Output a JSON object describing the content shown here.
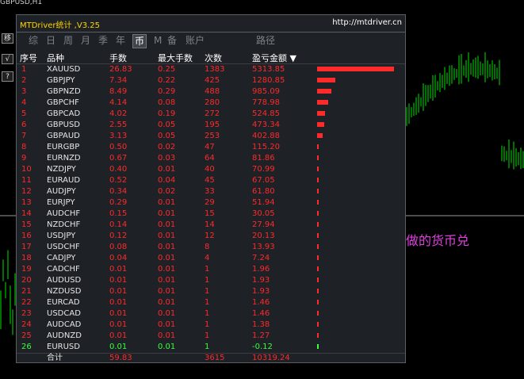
{
  "chart": {
    "title": "GBPUSD,H1",
    "overlay_text": "金蝉子做的货币兑"
  },
  "side_buttons": [
    "移",
    "√",
    "?"
  ],
  "panel": {
    "title": "MTDriver统计 ,V3.25",
    "url": "http://mtdriver.cn",
    "tabs": [
      "综",
      "日",
      "周",
      "月",
      "季",
      "年",
      "币",
      "M",
      "备",
      "账户",
      "路径"
    ],
    "active_tab": "币",
    "columns": {
      "idx": "序号",
      "symbol": "品种",
      "lots": "手数",
      "max_lots": "最大手数",
      "count": "次数",
      "pnl": "盈亏金额 ▼"
    },
    "rows": [
      {
        "idx": "1",
        "symbol": "XAUUSD",
        "lots": "26.83",
        "max_lots": "0.25",
        "count": "1383",
        "pnl": "5313.85",
        "value": 5313.85
      },
      {
        "idx": "2",
        "symbol": "GBPJPY",
        "lots": "7.34",
        "max_lots": "0.22",
        "count": "425",
        "pnl": "1280.85",
        "value": 1280.85
      },
      {
        "idx": "3",
        "symbol": "GBPNZD",
        "lots": "8.49",
        "max_lots": "0.29",
        "count": "488",
        "pnl": "985.09",
        "value": 985.09
      },
      {
        "idx": "4",
        "symbol": "GBPCHF",
        "lots": "4.14",
        "max_lots": "0.08",
        "count": "280",
        "pnl": "778.98",
        "value": 778.98
      },
      {
        "idx": "5",
        "symbol": "GBPCAD",
        "lots": "4.02",
        "max_lots": "0.19",
        "count": "272",
        "pnl": "524.85",
        "value": 524.85
      },
      {
        "idx": "6",
        "symbol": "GBPUSD",
        "lots": "2.55",
        "max_lots": "0.05",
        "count": "195",
        "pnl": "473.34",
        "value": 473.34
      },
      {
        "idx": "7",
        "symbol": "GBPAUD",
        "lots": "3.13",
        "max_lots": "0.05",
        "count": "253",
        "pnl": "402.88",
        "value": 402.88
      },
      {
        "idx": "8",
        "symbol": "EURGBP",
        "lots": "0.50",
        "max_lots": "0.02",
        "count": "47",
        "pnl": "115.20",
        "value": 115.2
      },
      {
        "idx": "9",
        "symbol": "EURNZD",
        "lots": "0.67",
        "max_lots": "0.03",
        "count": "64",
        "pnl": "81.86",
        "value": 81.86
      },
      {
        "idx": "10",
        "symbol": "NZDJPY",
        "lots": "0.40",
        "max_lots": "0.01",
        "count": "40",
        "pnl": "70.99",
        "value": 70.99
      },
      {
        "idx": "11",
        "symbol": "EURAUD",
        "lots": "0.52",
        "max_lots": "0.04",
        "count": "45",
        "pnl": "67.05",
        "value": 67.05
      },
      {
        "idx": "12",
        "symbol": "AUDJPY",
        "lots": "0.34",
        "max_lots": "0.02",
        "count": "33",
        "pnl": "61.80",
        "value": 61.8
      },
      {
        "idx": "13",
        "symbol": "EURJPY",
        "lots": "0.29",
        "max_lots": "0.01",
        "count": "29",
        "pnl": "51.94",
        "value": 51.94
      },
      {
        "idx": "14",
        "symbol": "AUDCHF",
        "lots": "0.15",
        "max_lots": "0.01",
        "count": "15",
        "pnl": "30.05",
        "value": 30.05
      },
      {
        "idx": "15",
        "symbol": "NZDCHF",
        "lots": "0.14",
        "max_lots": "0.01",
        "count": "14",
        "pnl": "27.94",
        "value": 27.94
      },
      {
        "idx": "16",
        "symbol": "USDJPY",
        "lots": "0.12",
        "max_lots": "0.01",
        "count": "12",
        "pnl": "20.13",
        "value": 20.13
      },
      {
        "idx": "17",
        "symbol": "USDCHF",
        "lots": "0.08",
        "max_lots": "0.01",
        "count": "8",
        "pnl": "13.93",
        "value": 13.93
      },
      {
        "idx": "18",
        "symbol": "CADJPY",
        "lots": "0.04",
        "max_lots": "0.01",
        "count": "4",
        "pnl": "7.24",
        "value": 7.24
      },
      {
        "idx": "19",
        "symbol": "CADCHF",
        "lots": "0.01",
        "max_lots": "0.01",
        "count": "1",
        "pnl": "1.96",
        "value": 1.96
      },
      {
        "idx": "20",
        "symbol": "AUDUSD",
        "lots": "0.01",
        "max_lots": "0.01",
        "count": "1",
        "pnl": "1.93",
        "value": 1.93
      },
      {
        "idx": "21",
        "symbol": "NZDUSD",
        "lots": "0.01",
        "max_lots": "0.01",
        "count": "1",
        "pnl": "1.93",
        "value": 1.93
      },
      {
        "idx": "22",
        "symbol": "EURCAD",
        "lots": "0.01",
        "max_lots": "0.01",
        "count": "1",
        "pnl": "1.46",
        "value": 1.46
      },
      {
        "idx": "23",
        "symbol": "USDCAD",
        "lots": "0.01",
        "max_lots": "0.01",
        "count": "1",
        "pnl": "1.46",
        "value": 1.46
      },
      {
        "idx": "24",
        "symbol": "AUDCAD",
        "lots": "0.01",
        "max_lots": "0.01",
        "count": "1",
        "pnl": "1.38",
        "value": 1.38
      },
      {
        "idx": "25",
        "symbol": "AUDNZD",
        "lots": "0.01",
        "max_lots": "0.01",
        "count": "1",
        "pnl": "1.27",
        "value": 1.27
      },
      {
        "idx": "26",
        "symbol": "EURUSD",
        "lots": "0.01",
        "max_lots": "0.01",
        "count": "1",
        "pnl": "-0.12",
        "value": -0.12
      }
    ],
    "total": {
      "label": "合计",
      "lots": "59.83",
      "count": "3615",
      "pnl": "10319.24"
    }
  },
  "colors": {
    "profit": "#ff2a2a",
    "loss": "#3aff3a",
    "title": "#ffd400",
    "candle": "#00e000"
  }
}
